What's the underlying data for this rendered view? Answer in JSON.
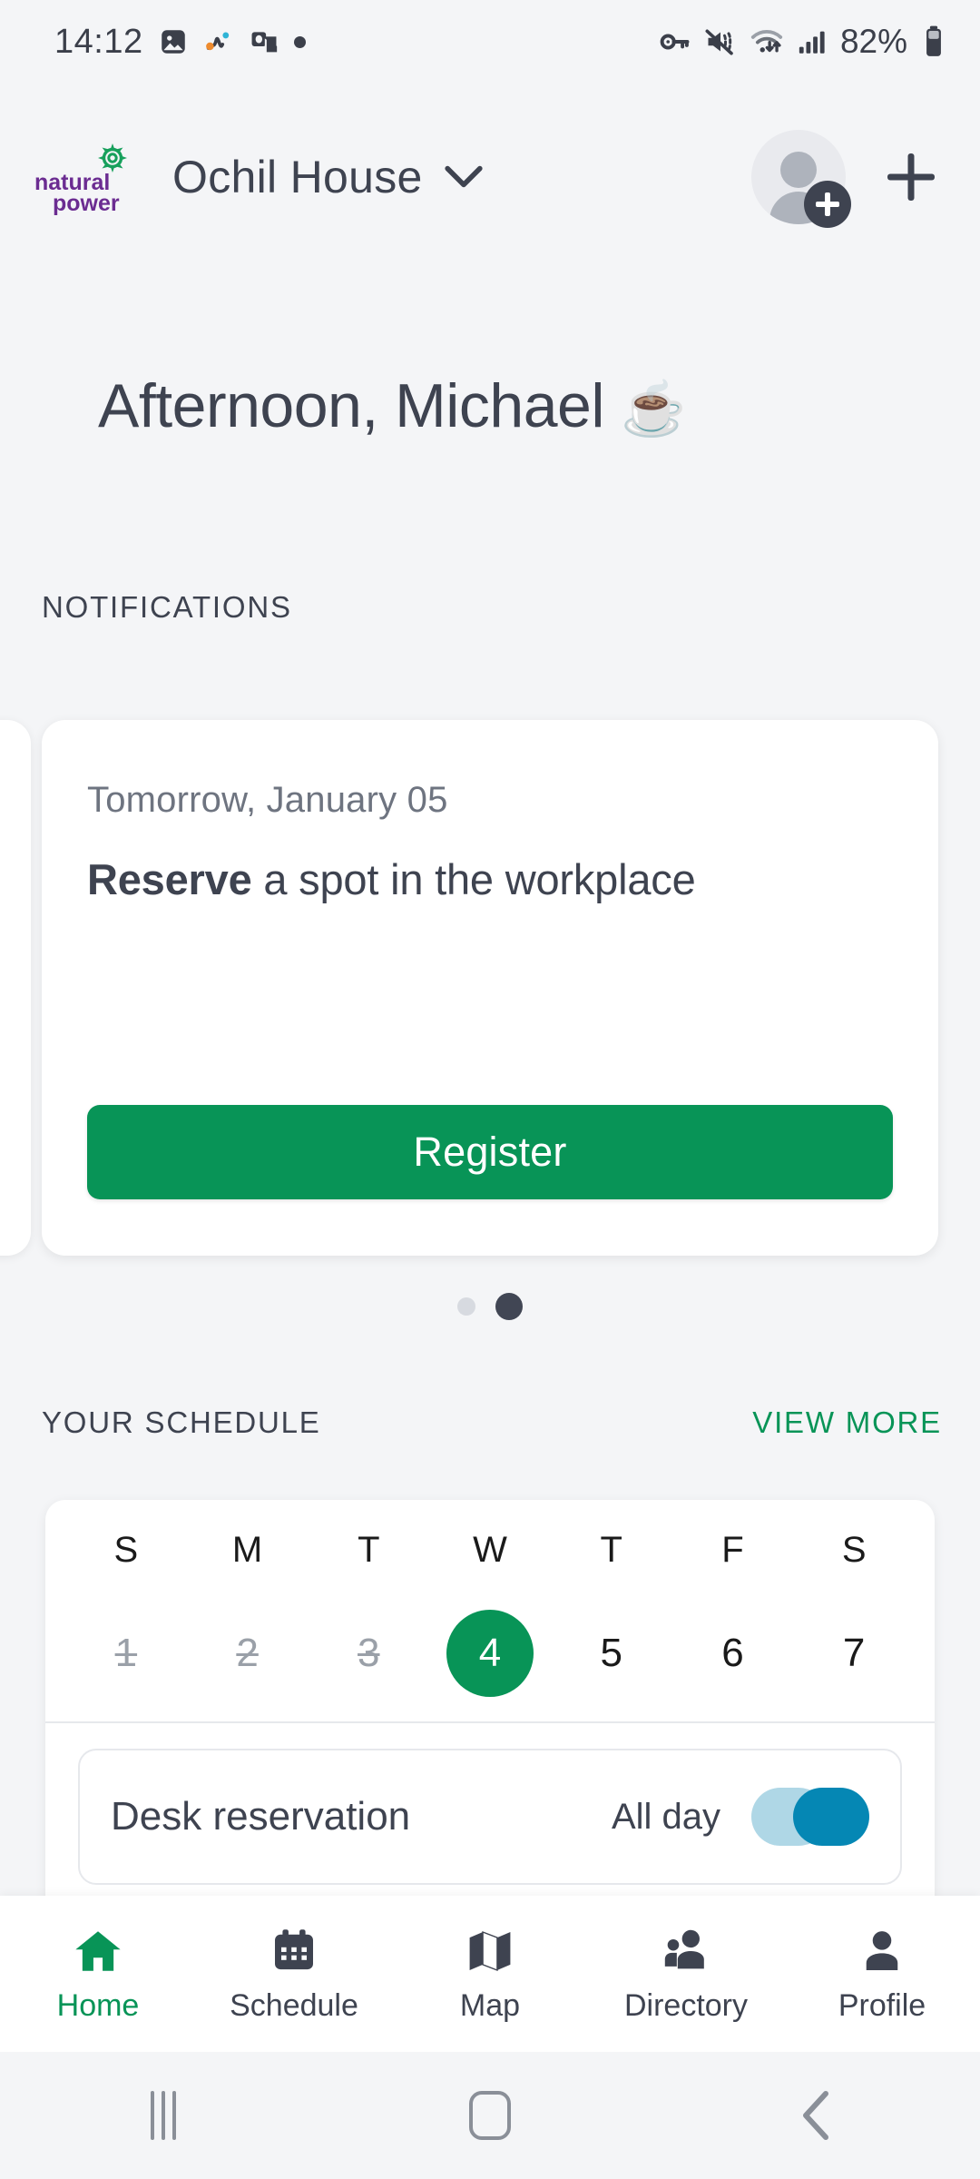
{
  "status_bar": {
    "time": "14:12",
    "battery_percent": "82%",
    "left_icons": [
      "image-icon",
      "activity-icon",
      "outlook-icon",
      "dot-icon"
    ],
    "right_icons": [
      "vpn-key-icon",
      "mute-vibrate-icon",
      "wifi-icon",
      "signal-icon",
      "battery-icon"
    ]
  },
  "header": {
    "logo_line1": "natural",
    "logo_line2": "power",
    "site_name": "Ochil House",
    "chevron": "chevron-down-icon",
    "avatar": "avatar-add-person",
    "add": "plus-icon"
  },
  "greeting": {
    "text": "Afternoon, Michael",
    "emoji": "☕"
  },
  "notifications": {
    "label": "NOTIFICATIONS",
    "card": {
      "date": "Tomorrow, January 05",
      "title_bold": "Reserve",
      "title_rest": " a spot in the workplace",
      "cta_label": "Register"
    },
    "pager": {
      "count": 2,
      "active_index": 1
    }
  },
  "schedule": {
    "label": "YOUR SCHEDULE",
    "view_more": "VIEW MORE",
    "weekdays": [
      "S",
      "M",
      "T",
      "W",
      "T",
      "F",
      "S"
    ],
    "dates": [
      {
        "num": "1",
        "state": "past"
      },
      {
        "num": "2",
        "state": "past"
      },
      {
        "num": "3",
        "state": "past"
      },
      {
        "num": "4",
        "state": "selected"
      },
      {
        "num": "5",
        "state": "normal"
      },
      {
        "num": "6",
        "state": "normal"
      },
      {
        "num": "7",
        "state": "normal"
      }
    ],
    "event": {
      "title": "Desk reservation",
      "meta": "All day"
    }
  },
  "bottom_nav": [
    {
      "label": "Home",
      "icon": "home-icon",
      "active": true
    },
    {
      "label": "Schedule",
      "icon": "calendar-icon",
      "active": false
    },
    {
      "label": "Map",
      "icon": "map-icon",
      "active": false
    },
    {
      "label": "Directory",
      "icon": "people-icon",
      "active": false
    },
    {
      "label": "Profile",
      "icon": "person-icon",
      "active": false
    }
  ],
  "android_nav": [
    "recents-icon",
    "home-icon",
    "back-icon"
  ],
  "colors": {
    "brand_green": "#089457",
    "brand_purple": "#6B2C91",
    "logo_green": "#17A05C",
    "text_dark": "#3E4350",
    "background": "#F4F5F7",
    "accent_blue": "#0587B4"
  }
}
